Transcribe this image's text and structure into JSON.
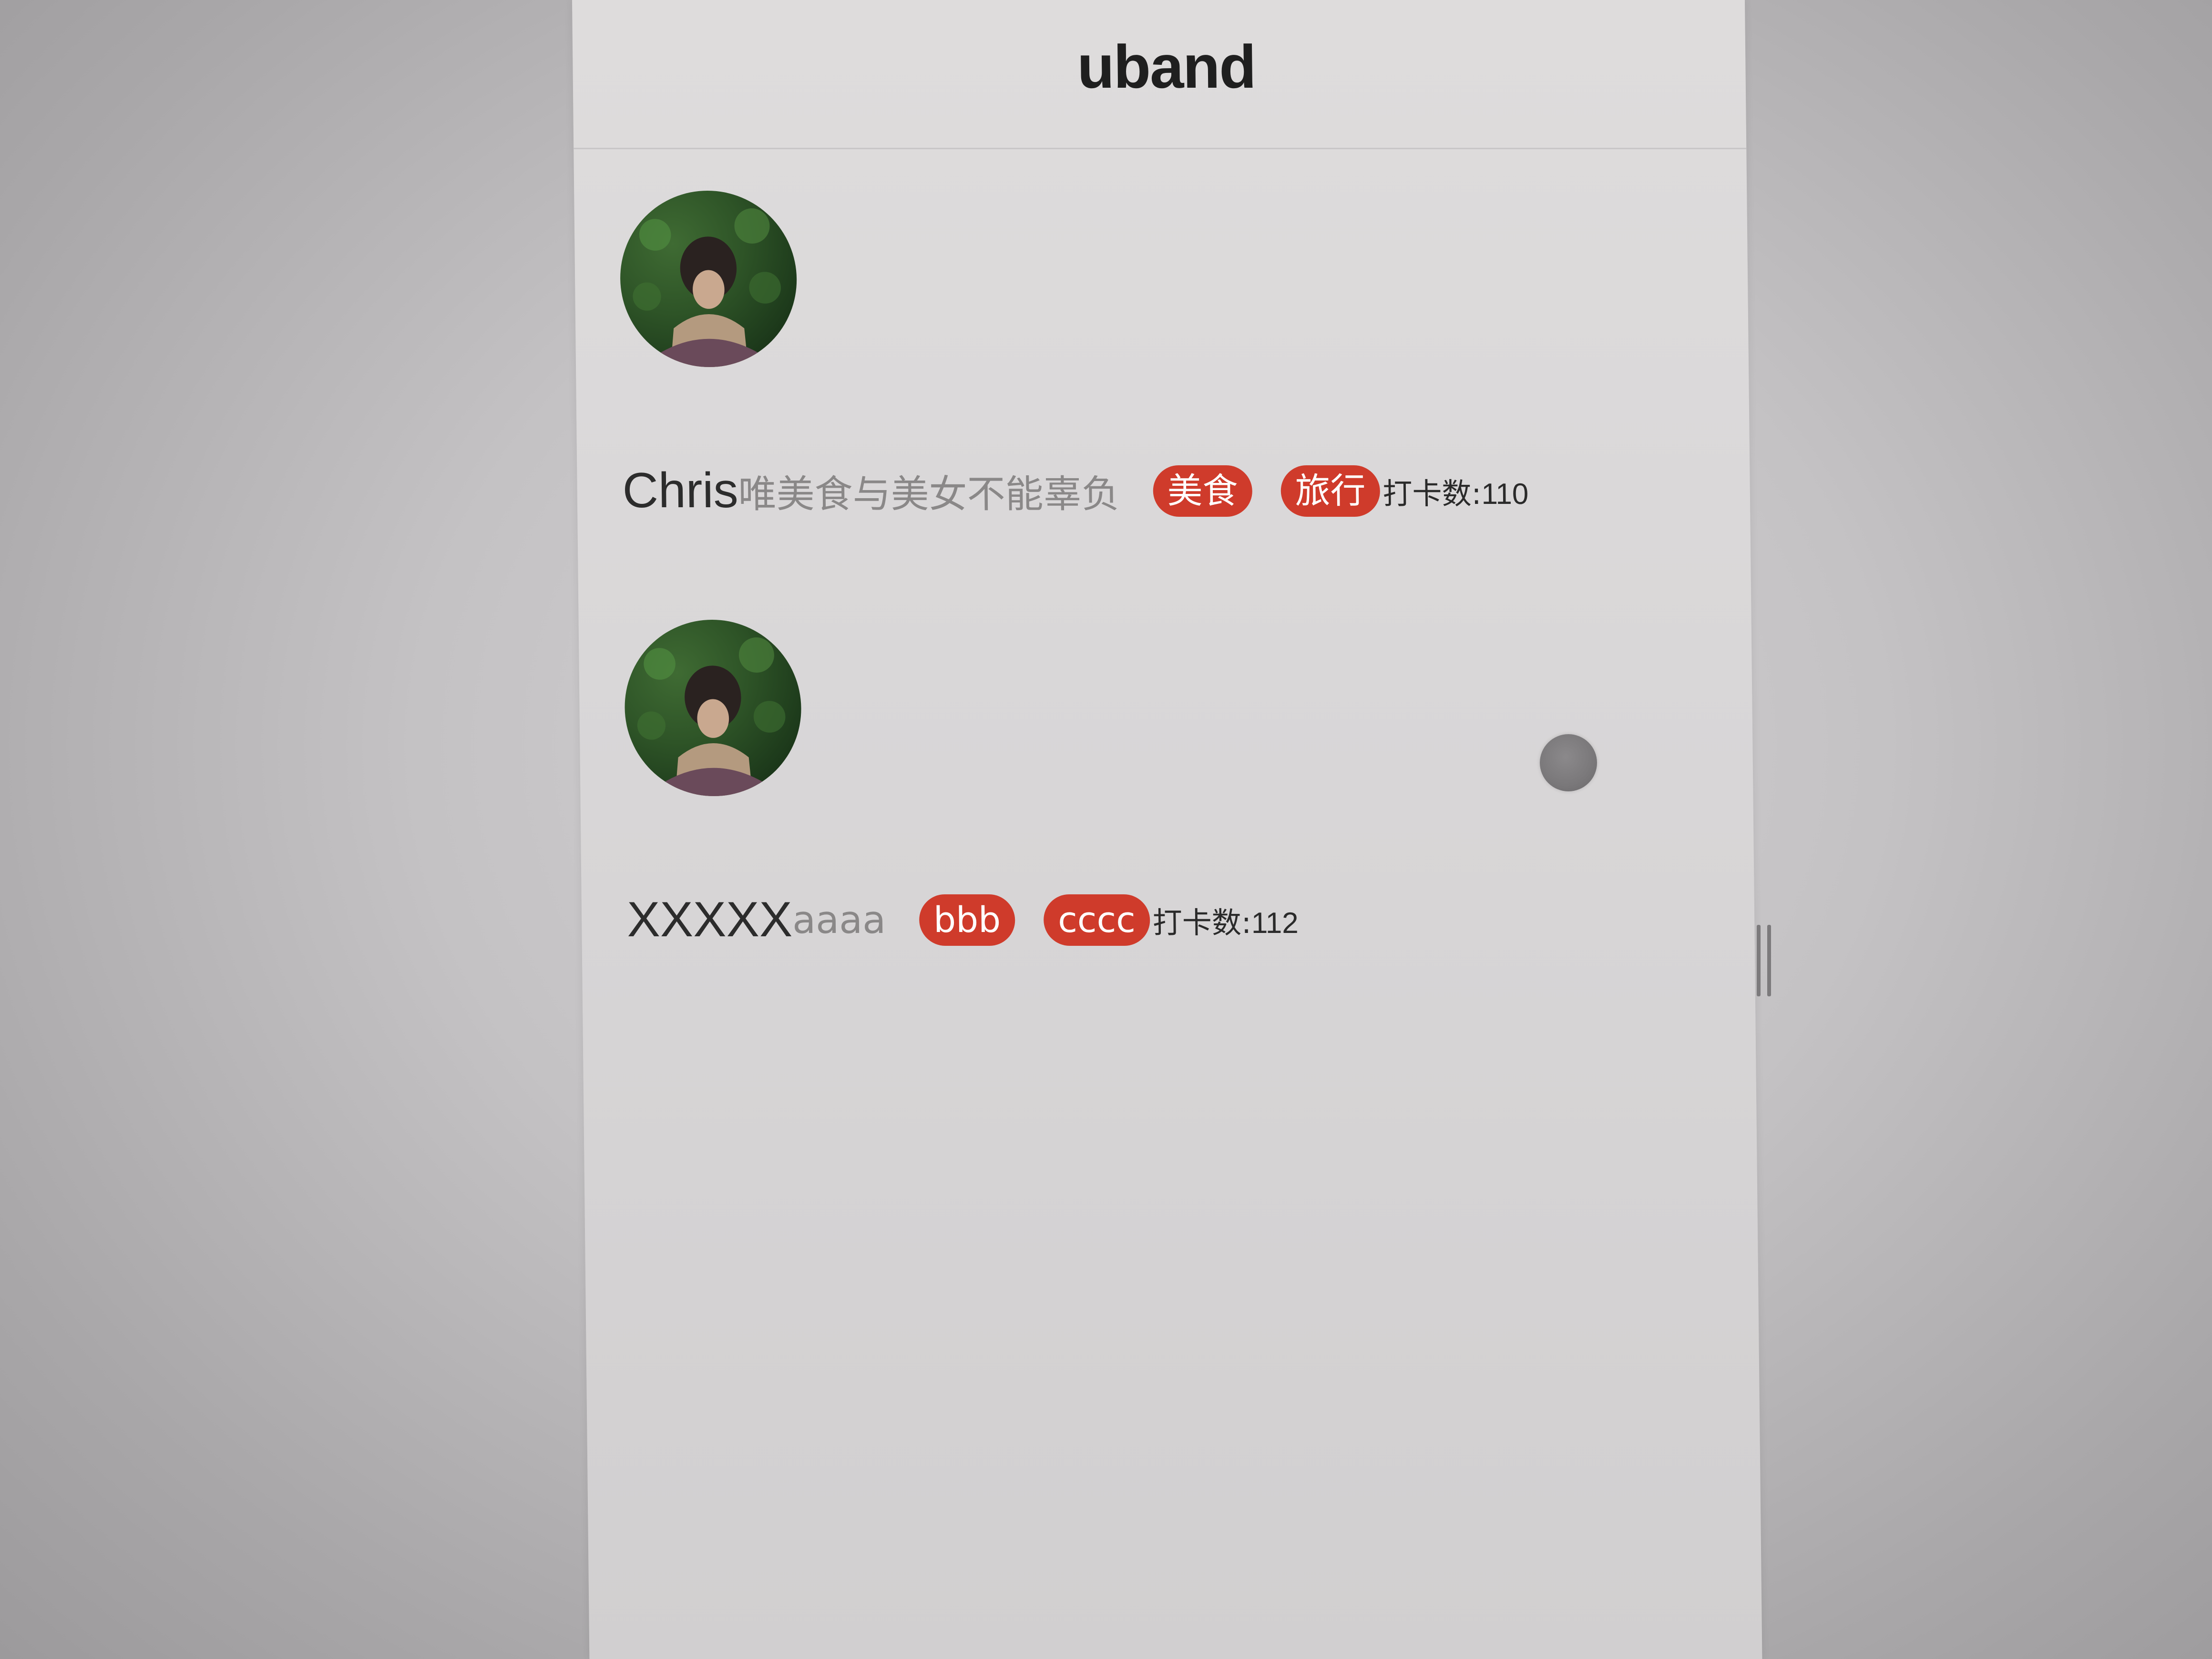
{
  "header": {
    "logo_text": "uband"
  },
  "users": [
    {
      "name": "Chris",
      "bio": "唯美食与美女不能辜负",
      "tags": [
        "美食",
        "旅行"
      ],
      "count_label": "打卡数:",
      "count_value": "110"
    },
    {
      "name": "XXXXX",
      "bio": "aaaa",
      "tags": [
        "bbb",
        "cccc"
      ],
      "count_label": "打卡数:",
      "count_value": "112"
    }
  ],
  "colors": {
    "tag_background": "#cf3b2b",
    "tag_text": "#ffffff",
    "name_text": "#2c2c2c",
    "bio_text": "#8a8888"
  },
  "icons": {
    "floating_button": "floating-dot-icon",
    "scroll_handle": "scroll-handle-icon"
  }
}
